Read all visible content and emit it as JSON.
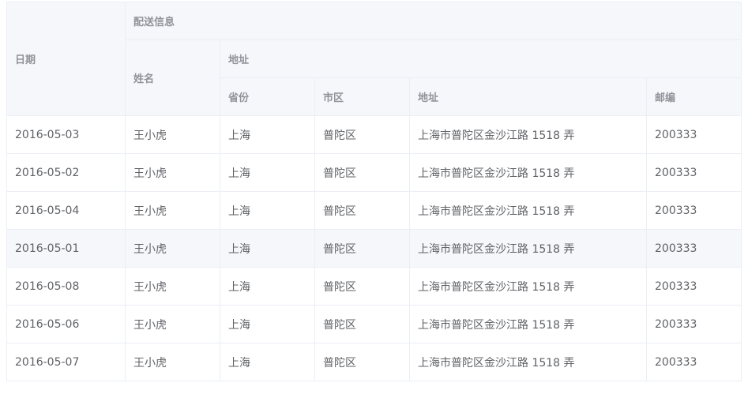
{
  "headers": {
    "date": "日期",
    "delivery": "配送信息",
    "name": "姓名",
    "address_group": "地址",
    "province": "省份",
    "city": "市区",
    "address": "地址",
    "zip": "邮编"
  },
  "rows": [
    {
      "date": "2016-05-03",
      "name": "王小虎",
      "province": "上海",
      "city": "普陀区",
      "address": "上海市普陀区金沙江路 1518 弄",
      "zip": "200333"
    },
    {
      "date": "2016-05-02",
      "name": "王小虎",
      "province": "上海",
      "city": "普陀区",
      "address": "上海市普陀区金沙江路 1518 弄",
      "zip": "200333"
    },
    {
      "date": "2016-05-04",
      "name": "王小虎",
      "province": "上海",
      "city": "普陀区",
      "address": "上海市普陀区金沙江路 1518 弄",
      "zip": "200333"
    },
    {
      "date": "2016-05-01",
      "name": "王小虎",
      "province": "上海",
      "city": "普陀区",
      "address": "上海市普陀区金沙江路 1518 弄",
      "zip": "200333"
    },
    {
      "date": "2016-05-08",
      "name": "王小虎",
      "province": "上海",
      "city": "普陀区",
      "address": "上海市普陀区金沙江路 1518 弄",
      "zip": "200333"
    },
    {
      "date": "2016-05-06",
      "name": "王小虎",
      "province": "上海",
      "city": "普陀区",
      "address": "上海市普陀区金沙江路 1518 弄",
      "zip": "200333"
    },
    {
      "date": "2016-05-07",
      "name": "王小虎",
      "province": "上海",
      "city": "普陀区",
      "address": "上海市普陀区金沙江路 1518 弄",
      "zip": "200333"
    }
  ],
  "highlighted_row": 3
}
